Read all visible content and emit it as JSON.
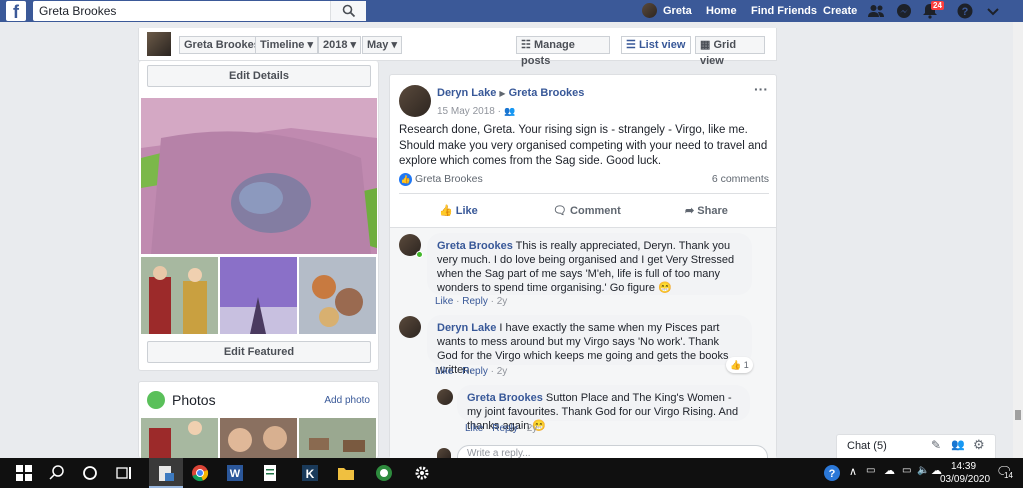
{
  "topbar": {
    "search_value": "Greta Brookes",
    "profile_name": "Greta",
    "home": "Home",
    "find_friends": "Find Friends",
    "create": "Create",
    "notification_count": "24"
  },
  "subbar": {
    "profile_select": "Greta Brookes",
    "timeline_select": "Timeline",
    "year_select": "2018",
    "month_select": "May",
    "manage_posts": "Manage posts",
    "list_view": "List view",
    "grid_view": "Grid view"
  },
  "left": {
    "edit_details": "Edit Details",
    "edit_featured": "Edit Featured",
    "photos_title": "Photos",
    "add_photo": "Add photo"
  },
  "post": {
    "author": "Deryn Lake",
    "target": "Greta Brookes",
    "date": "15 May 2018 ·",
    "body": "Research done, Greta. Your rising sign is - strangely - Virgo, like me. Should make you very organised competing with your need to travel and explore which comes from the Sag side. Good luck.",
    "reactor": "Greta Brookes",
    "comments_count": "6 comments",
    "like": "Like",
    "comment": "Comment",
    "share": "Share"
  },
  "comments": [
    {
      "author": "Greta Brookes",
      "text": "This is really appreciated, Deryn. Thank you very much. I do love being organised and I get Very Stressed when the Sag part of me says 'M'eh, life is full of too many wonders to spend time organising.' Go figure 😁",
      "like": "Like",
      "reply": "Reply",
      "age": "2y"
    },
    {
      "author": "Deryn Lake",
      "text": "I have exactly the same when my Pisces part wants to mess around but my Virgo says 'No work'. Thank God for the Virgo which keeps me going and gets the books written.",
      "like": "Like",
      "reply": "Reply",
      "age": "2y",
      "reaction_count": "1"
    },
    {
      "author": "Greta Brookes",
      "text": "Sutton Place and The King's Women - my joint favourites. Thank God for our Virgo Rising. And thanks again 😁",
      "like": "Like",
      "reply": "Reply",
      "age": "2y"
    }
  ],
  "reply_placeholder": "Write a reply...",
  "chat": {
    "label": "Chat (5)"
  },
  "taskbar": {
    "time": "14:39",
    "date": "03/09/2020",
    "notif_count": "14"
  },
  "colors": {
    "brand": "#3b5998",
    "link": "#385898"
  }
}
